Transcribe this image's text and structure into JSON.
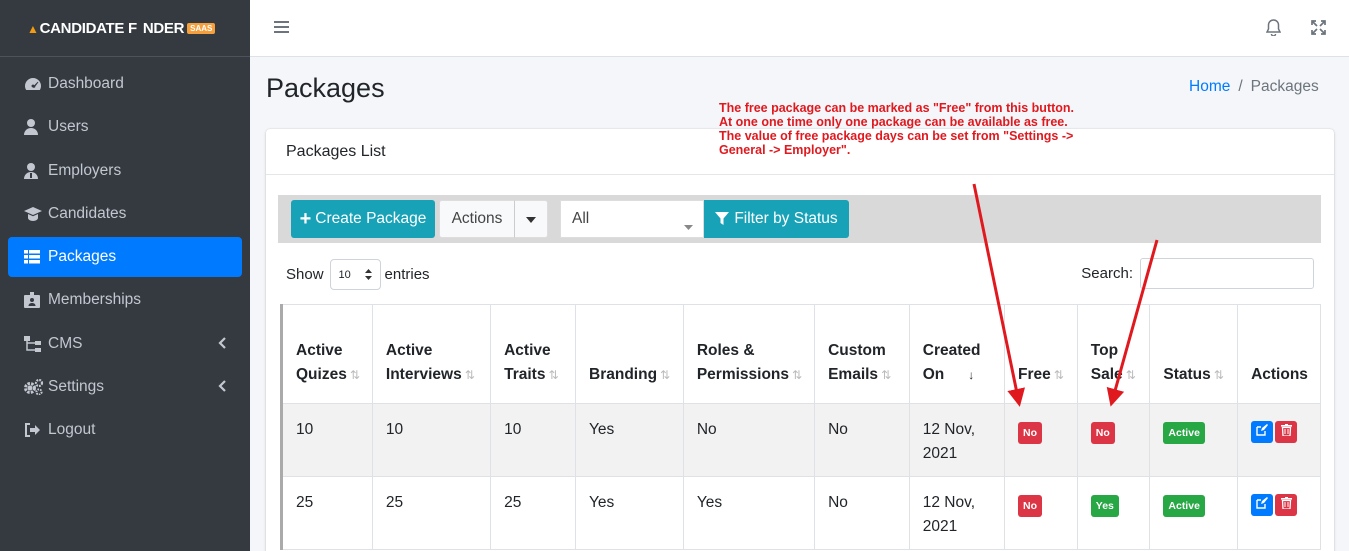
{
  "brand": {
    "text_a": "C",
    "text_b": "ANDIDATE F",
    "text_c": "NDER",
    "badge": "SAAS"
  },
  "sidebar": {
    "items": [
      {
        "label": "Dashboard",
        "icon": "dashboard-icon"
      },
      {
        "label": "Users",
        "icon": "user-icon"
      },
      {
        "label": "Employers",
        "icon": "employer-icon"
      },
      {
        "label": "Candidates",
        "icon": "graduation-cap-icon"
      },
      {
        "label": "Packages",
        "icon": "list-icon",
        "active": true
      },
      {
        "label": "Memberships",
        "icon": "id-badge-icon"
      },
      {
        "label": "CMS",
        "icon": "sitemap-icon",
        "arrow": true
      },
      {
        "label": "Settings",
        "icon": "cogs-icon",
        "arrow": true
      },
      {
        "label": "Logout",
        "icon": "sign-out-icon"
      }
    ]
  },
  "header": {
    "title": "Packages",
    "breadcrumb_home": "Home",
    "breadcrumb_sep": "/",
    "breadcrumb_current": "Packages"
  },
  "annotation": {
    "lines": [
      "The free package can be marked as \"Free\" from this button.",
      "At one one time only one package can be available as free.",
      "The value of free package days can be set from \"Settings ->",
      "General -> Employer\"."
    ],
    "color": "#e0191f"
  },
  "card": {
    "title": "Packages List"
  },
  "toolbar": {
    "create_label": "Create Package",
    "actions_label": "Actions",
    "status_value": "All",
    "filter_label": "Filter by Status"
  },
  "table_controls": {
    "show_label": "Show",
    "entries_value": "10",
    "entries_label": "entries",
    "search_label": "Search:"
  },
  "table": {
    "columns": [
      {
        "line1": "Active",
        "line2": "Quizes"
      },
      {
        "line1": "Active",
        "line2": "Interviews"
      },
      {
        "line1": "Active",
        "line2": "Traits"
      },
      {
        "line1": "",
        "line2": "Branding"
      },
      {
        "line1": "Roles &",
        "line2": "Permissions"
      },
      {
        "line1": "Custom",
        "line2": "Emails"
      },
      {
        "line1": "Created",
        "line2": "On"
      },
      {
        "line1": "",
        "line2": "Free"
      },
      {
        "line1": "Top",
        "line2": "Sale"
      },
      {
        "line1": "",
        "line2": "Status"
      },
      {
        "line1": "",
        "line2": "Actions"
      }
    ],
    "rows": [
      {
        "quizes": "10",
        "interviews": "10",
        "traits": "10",
        "branding": "Yes",
        "roles": "No",
        "emails": "No",
        "created_line1": "12 Nov,",
        "created_line2": "2021",
        "free": "No",
        "top_sale": "No",
        "status": "Active"
      },
      {
        "quizes": "25",
        "interviews": "25",
        "traits": "25",
        "branding": "Yes",
        "roles": "Yes",
        "emails": "No",
        "created_line1": "12 Nov,",
        "created_line2": "2021",
        "free": "No",
        "top_sale": "Yes",
        "status": "Active"
      }
    ]
  },
  "colors": {
    "accent": "#007bff",
    "teal": "#17a2b8",
    "danger": "#dc3545",
    "success": "#28a745",
    "sidebar": "#343a40"
  }
}
